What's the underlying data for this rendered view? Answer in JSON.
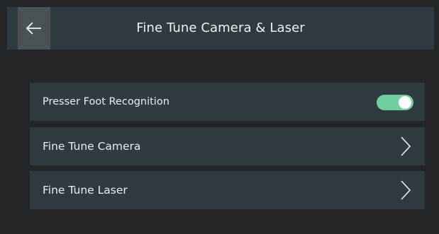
{
  "header": {
    "title": "Fine Tune Camera & Laser",
    "back_icon": "arrow-left-icon"
  },
  "settings": {
    "items": [
      {
        "label": "Presser Foot Recognition",
        "control": "toggle",
        "toggle_on": true
      },
      {
        "label": "Fine Tune Camera",
        "control": "chevron"
      },
      {
        "label": "Fine Tune Laser",
        "control": "chevron"
      }
    ]
  },
  "colors": {
    "background": "#232527",
    "panel": "#2f3b40",
    "back_button": "#4b5256",
    "toggle_on": "#6fcf9c",
    "text": "#e9eef0"
  }
}
